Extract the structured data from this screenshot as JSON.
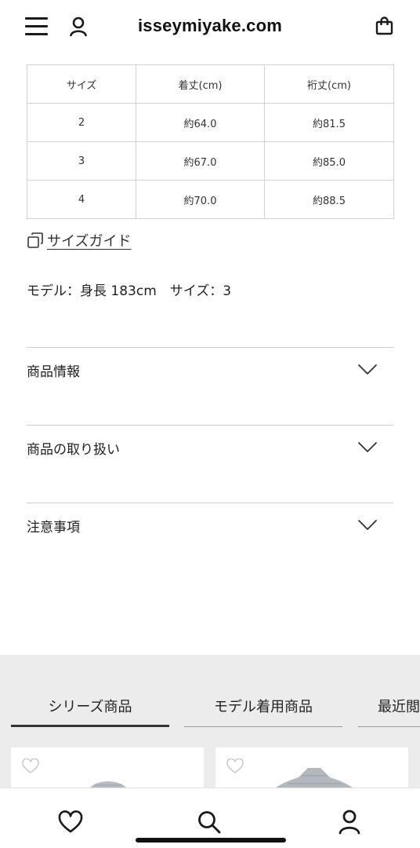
{
  "header": {
    "title": "isseymiyake.com",
    "menu_icon": "hamburger-menu-icon",
    "account_icon": "person-icon",
    "bag_icon": "shopping-bag-icon"
  },
  "size_table": {
    "headers": [
      "サイズ",
      "着丈(cm)",
      "裄丈(cm)"
    ],
    "rows": [
      [
        "2",
        "約64.0",
        "約81.5"
      ],
      [
        "3",
        "約67.0",
        "約85.0"
      ],
      [
        "4",
        "約70.0",
        "約88.5"
      ]
    ]
  },
  "size_guide": {
    "label": "サイズガイド",
    "icon": "copy-squares-icon"
  },
  "model_info": "モデル：身長 183cm　サイズ：3",
  "accordions": [
    {
      "label": "商品情報"
    },
    {
      "label": "商品の取り扱い"
    },
    {
      "label": "注意事項"
    }
  ],
  "tabs": [
    {
      "label": "シリーズ商品",
      "active": true
    },
    {
      "label": "モデル着用商品",
      "active": false
    },
    {
      "label": "最近閲",
      "active": false
    }
  ],
  "bottom_nav": {
    "icons": [
      "heart-icon",
      "search-icon",
      "person-icon"
    ]
  },
  "colors": {
    "background": "#ffffff",
    "text": "#222222",
    "border": "#d2d2d2",
    "section_bg": "#ececec"
  }
}
